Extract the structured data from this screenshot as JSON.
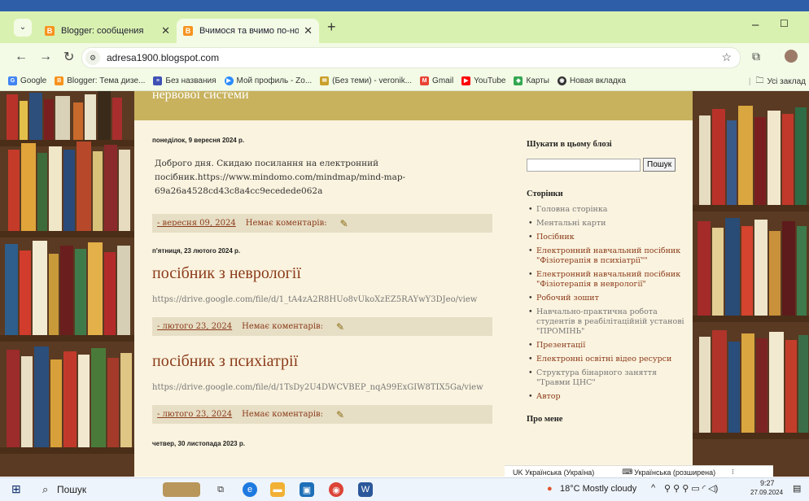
{
  "browser": {
    "tabs": [
      {
        "title": "Blogger: сообщения",
        "active": false
      },
      {
        "title": "Вчимося та вчимо по-новому",
        "active": true
      }
    ],
    "new_tab_glyph": "+",
    "url": "adresa1900.blogspot.com",
    "bookmarks": [
      {
        "label": "Google",
        "icon": "google-icon",
        "color": "#4285f4"
      },
      {
        "label": "Blogger: Тема дизе...",
        "icon": "blogger-icon",
        "color": "#f7931e"
      },
      {
        "label": "Без названия",
        "icon": "forms-icon",
        "color": "#3f51b5"
      },
      {
        "label": "Мой профиль - Zo...",
        "icon": "zoom-icon",
        "color": "#2d8cff"
      },
      {
        "label": "(Без теми) - veronik...",
        "icon": "mail-icon",
        "color": "#caa02a"
      },
      {
        "label": "Gmail",
        "icon": "gmail-icon",
        "color": "#ea4335"
      },
      {
        "label": "YouTube",
        "icon": "youtube-icon",
        "color": "#ff0000"
      },
      {
        "label": "Карты",
        "icon": "maps-icon",
        "color": "#34a853"
      },
      {
        "label": "Новая вкладка",
        "icon": "chrome-icon",
        "color": "#333333"
      }
    ],
    "all_bookmarks": "Усі заклад"
  },
  "blog": {
    "header_title": "нервової системи",
    "posts": [
      {
        "date": "понеділок, 9 вересня 2024 р.",
        "title": "",
        "body": "Доброго дня. Скидаю посилання на електронний посібник.https://www.mindomo.com/mindmap/mind-map-69a26a4528cd43c8a4cc9ecedede062a",
        "footer_date": "- вересня 09, 2024",
        "comments": "Немає коментарів:"
      },
      {
        "date": "п'ятниця, 23 лютого 2024 р.",
        "title": "посібник з неврології",
        "body": "https://drive.google.com/file/d/1_tA4zA2R8HUo8vUkoXzEZ5RAYwY3DJeo/view",
        "footer_date": "- лютого 23, 2024",
        "comments": "Немає коментарів:"
      },
      {
        "date": "",
        "title": "посібник з психіатрії",
        "body": "https://drive.google.com/file/d/1TsDy2U4DWCVBEP_nqA99ExGIW8TIX5Ga/view",
        "footer_date": "- лютого 23, 2024",
        "comments": "Немає коментарів:"
      }
    ],
    "next_date": "четвер, 30 листопада 2023 р.",
    "sidebar": {
      "search_heading": "Шукати в цьому блозі",
      "search_button": "Пошук",
      "pages_heading": "Сторінки",
      "pages": [
        "Головна сторінка",
        "Ментальні карти",
        "Посібник",
        "Електронний навчальний посібник \"Фізіотерапія в психіатрії\"\"",
        "Електронний навчальний посібник \"Фізіотерапія в неврології\"",
        "Робочий зошит",
        "Навчально-практична робота студентів в реабілітаційній установі \"ПРОМІНЬ\"",
        "Презентації",
        "Електронні освітні відео ресурси",
        "Структура бінарного заняття \"Травми ЦНС\"",
        "Автор"
      ],
      "about_heading": "Про мене"
    }
  },
  "language_bar": {
    "left": "UK Українська (Україна)",
    "right": "Українська (розширена)"
  },
  "taskbar": {
    "search_label": "Пошук",
    "weather": "18°C  Mostly cloudy",
    "time": "9:27",
    "date": "27.09.2024"
  }
}
